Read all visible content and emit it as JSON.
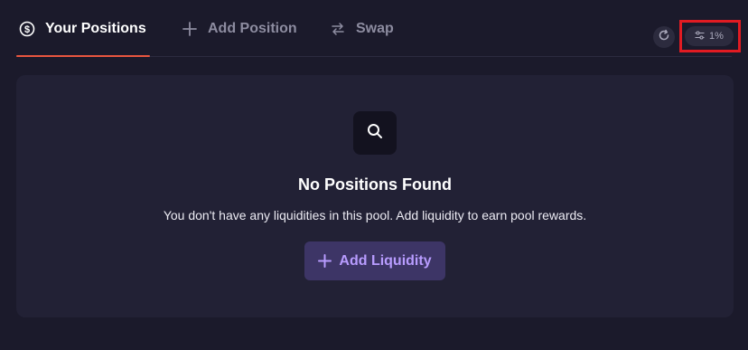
{
  "tabs": {
    "positions": {
      "label": "Your Positions",
      "icon": "dollar-circle-icon"
    },
    "add_position": {
      "label": "Add Position",
      "icon": "plus-icon"
    },
    "swap": {
      "label": "Swap",
      "icon": "swap-arrows-icon"
    }
  },
  "toolbar": {
    "refresh_icon": "refresh-icon",
    "slippage_icon": "settings-sliders-icon",
    "slippage_value": "1%"
  },
  "empty_state": {
    "icon": "search-icon",
    "title": "No Positions Found",
    "description": "You don't have any liquidities in this pool. Add liquidity to earn pool rewards.",
    "button_label": "Add Liquidity"
  },
  "colors": {
    "background": "#1b1a2b",
    "card": "#222135",
    "active_tab_underline": "#e8563f",
    "primary_button_bg": "#3d3566",
    "primary_button_text": "#b89cff",
    "highlight": "#e11b22"
  }
}
